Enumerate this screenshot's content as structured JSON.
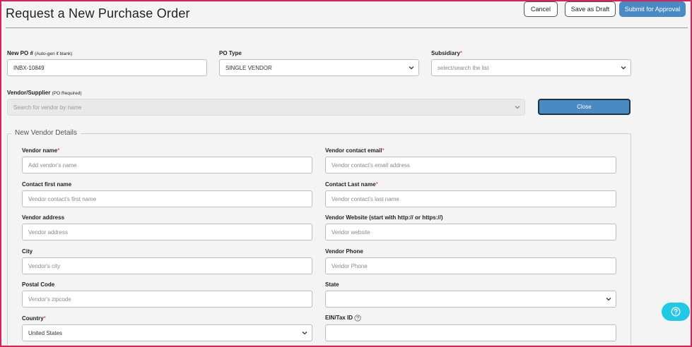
{
  "page": {
    "title": "Request a New Purchase Order"
  },
  "actions": {
    "cancel_label": "Cancel",
    "save_draft_label": "Save as Draft",
    "submit_label": "Submit for Approval"
  },
  "po_number": {
    "label": "New PO #",
    "hint": "(Auto-gen if blank)",
    "value": "INBX-10849"
  },
  "po_type": {
    "label": "PO Type",
    "value": "SINGLE VENDOR"
  },
  "subsidiary": {
    "label": "Subsidiary",
    "required_mark": "*",
    "placeholder": "select/search the list"
  },
  "vendor_supplier": {
    "label": "Vendor/Supplier",
    "hint": "(PO Required)",
    "placeholder": "Search for vendor by name"
  },
  "close_label": "Close",
  "new_vendor": {
    "legend": "New Vendor Details",
    "required_mark": "*",
    "vendor_name": {
      "label": "Vendor name",
      "placeholder": "Add vendor's name"
    },
    "vendor_email": {
      "label": "Vendor contact email",
      "placeholder": "Vendor contact's email address"
    },
    "first_name": {
      "label": "Contact first name",
      "placeholder": "Vendor contact's first name"
    },
    "last_name": {
      "label": "Contact Last name",
      "placeholder": "Vendor contact's last name"
    },
    "address": {
      "label": "Vendor address",
      "placeholder": "Vendor address"
    },
    "website": {
      "label": "Vendor Website (start with http:// or https://)",
      "placeholder": "Vendor website"
    },
    "city": {
      "label": "City",
      "placeholder": "Vendor's city"
    },
    "phone": {
      "label": "Vendor Phone",
      "placeholder": "Vendor Phone"
    },
    "postal": {
      "label": "Postal Code",
      "placeholder": "Vendor's zipcode"
    },
    "state": {
      "label": "State",
      "value": ""
    },
    "country": {
      "label": "Country",
      "value": "United States"
    },
    "ein": {
      "label": "EIN/Tax ID",
      "value": ""
    }
  },
  "colors": {
    "primary": "#4a8ac4",
    "required": "#d6245a",
    "help": "#22c9e6",
    "frame": "#d6245a"
  },
  "icons": {
    "dropdown": "chevron-down-icon",
    "info": "question-circle-icon",
    "help": "help-icon"
  }
}
